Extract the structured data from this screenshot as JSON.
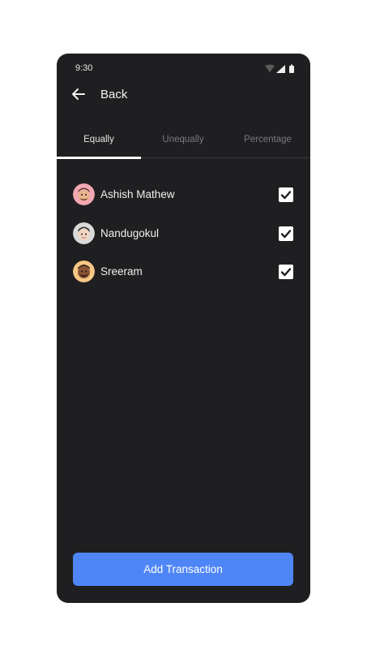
{
  "status_bar": {
    "time": "9:30"
  },
  "app_bar": {
    "back_label": "Back"
  },
  "tabs": [
    {
      "label": "Equally",
      "active": true
    },
    {
      "label": "Unequally",
      "active": false
    },
    {
      "label": "Percentage",
      "active": false
    }
  ],
  "members": [
    {
      "name": "Ashish Mathew",
      "checked": true,
      "avatar": "memoji-avatar-pink"
    },
    {
      "name": "Nandugokul",
      "checked": true,
      "avatar": "memoji-avatar-grey"
    },
    {
      "name": "Sreeram",
      "checked": true,
      "avatar": "memoji-avatar-orange"
    }
  ],
  "footer": {
    "button_label": "Add Transaction"
  },
  "colors": {
    "background": "#1f1f21",
    "accent": "#4f86f7",
    "text": "#f0f0f0",
    "muted": "#7a7a7c"
  }
}
